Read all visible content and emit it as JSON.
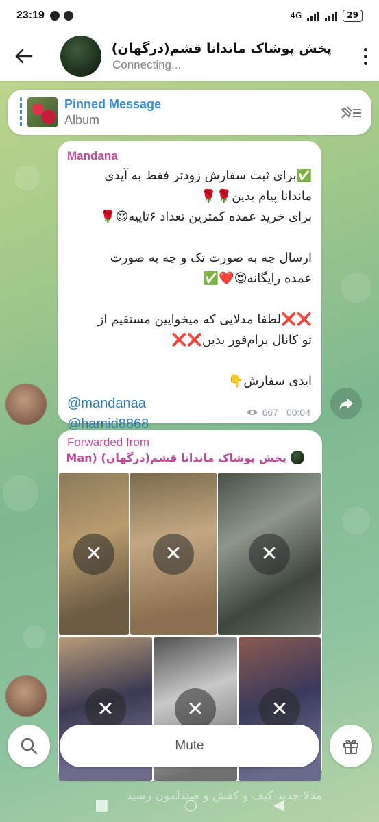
{
  "status_bar": {
    "time": "23:19",
    "network": "4G",
    "battery": "29"
  },
  "header": {
    "title": "پخش پوشاک ماندانا قشم(درگهان)",
    "status": "Connecting..."
  },
  "pinned": {
    "title": "Pinned Message",
    "subtitle": "Album"
  },
  "messages": [
    {
      "sender": "Mandana",
      "lines": [
        "✅برای ثبت سفارش زودتر فقط به آیدی",
        "ماندانا پیام بدین🌹🌹",
        "برای خرید عمده کمترین تعداد ۶تاییه😍🌹",
        "",
        "ارسال چه به صورت تک و چه به صورت",
        "عمده رایگانه😍❤️✅",
        "",
        "❌❌لطفا مدلایی که میخوایین مستقیم از",
        "تو کانال برام‌فور بدین❌❌",
        "",
        "ایدی سفارش👇"
      ],
      "links": [
        "@mandanaa",
        "@hamid8868"
      ],
      "views": "667",
      "time": "00:04"
    },
    {
      "forwarded_label": "Forwarded from",
      "forwarded_from": "پخش پوشاک ماندانا قشم(درگهان) (Man...",
      "album_count": 6
    }
  ],
  "bottom": {
    "mute_label": "Mute",
    "peek_text": "مدلا جدید کیف و کفش و صندلمون رسید"
  },
  "icons": {
    "back": "arrow-left-icon",
    "menu": "more-vertical-icon",
    "unpin": "unpin-icon",
    "share": "share-icon",
    "search": "search-icon",
    "gift": "gift-icon",
    "close": "close-icon"
  }
}
